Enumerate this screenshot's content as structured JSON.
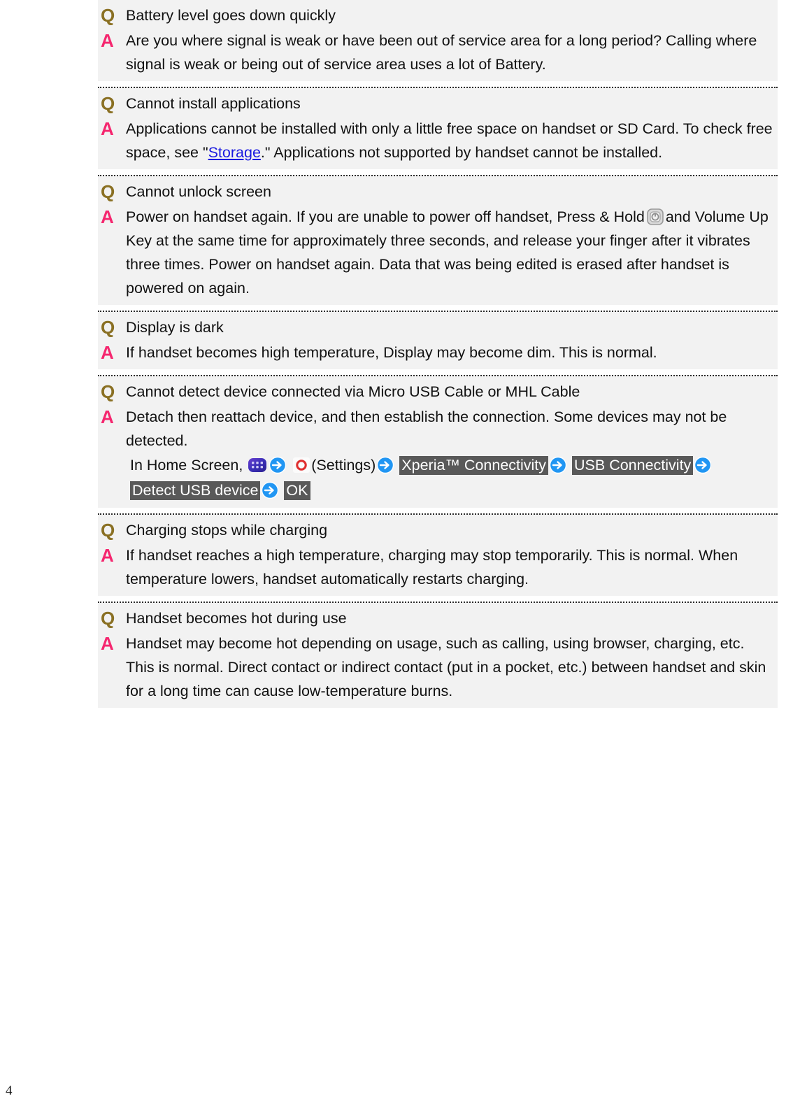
{
  "page": {
    "number": "4",
    "background": "#ffffff",
    "block_background": "#f2f2f2",
    "q_marker_color": "#8a7023",
    "a_marker_color": "#f5276f",
    "link_color": "#1a1ae0",
    "chip_background": "#595959",
    "chip_text_color": "#ffffff"
  },
  "markers": {
    "question": "Q",
    "answer": "A"
  },
  "faq": [
    {
      "question": "Battery level goes down quickly",
      "answer": "Are you where signal is weak or have been out of service area for a long period? Calling where signal is weak or being out of service area uses a lot of Battery."
    },
    {
      "question": "Cannot install applications",
      "answer_part_1": "Applications cannot be installed with only a little free space on handset or SD Card. To check free space, see \"",
      "answer_link": "Storage",
      "answer_part_2": ".\" Applications not supported by handset cannot be installed."
    },
    {
      "question": "Cannot unlock screen",
      "answer_part_1": "Power on handset again. If you are unable to power off handset, Press & Hold",
      "answer_icon": "power-key-icon",
      "answer_part_2": "and Volume Up Key at the same time for approximately three seconds, and release your finger after it vibrates three times. Power on handset again. Data that was being edited is erased after handset is powered on again."
    },
    {
      "question": "Display is dark",
      "answer": "If handset becomes high temperature, Display may become dim. This is normal."
    },
    {
      "question": "Cannot detect device connected via Micro USB Cable or MHL Cable",
      "answer_line_1": "Detach then reattach device, and then establish the connection. Some devices may not be detected.",
      "steps_prefix": "In Home Screen,",
      "steps_settings_label": "(Settings)",
      "steps": [
        "Xperia™  Connectivity",
        "USB Connectivity",
        "Detect USB device",
        "OK"
      ],
      "icons": [
        "app-drawer-icon",
        "arrow-right-icon",
        "settings-icon",
        "arrow-right-icon"
      ]
    },
    {
      "question": "Charging stops while charging",
      "answer": "If handset reaches a high temperature, charging may stop temporarily. This is normal. When temperature lowers, handset automatically restarts charging."
    },
    {
      "question": "Handset becomes hot during use",
      "answer": "Handset may become hot depending on usage, such as calling, using browser, charging, etc. This is normal. Direct contact or indirect contact (put in a pocket, etc.) between handset and skin for a long time can cause low-temperature burns."
    }
  ]
}
